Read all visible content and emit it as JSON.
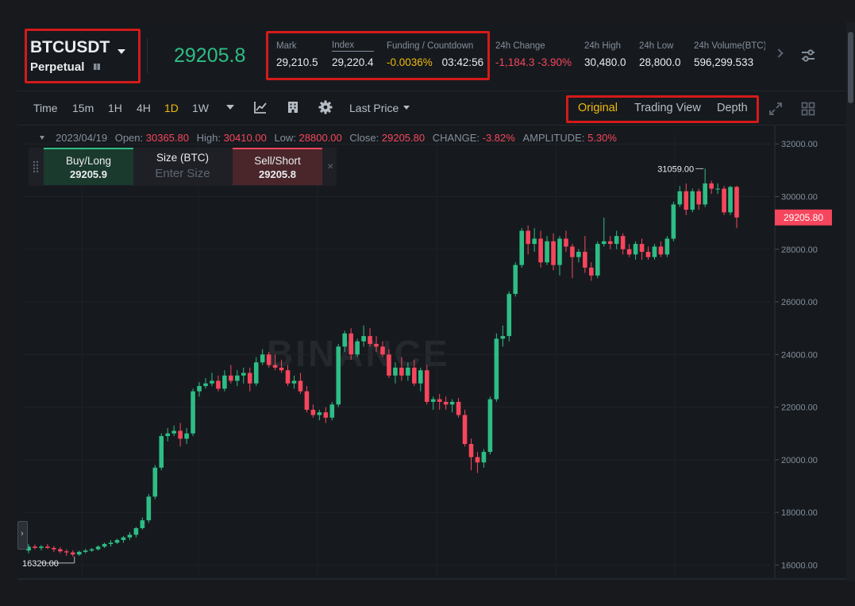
{
  "header": {
    "symbol": "BTCUSDT",
    "contract_type": "Perpetual",
    "last_price": "29205.8",
    "stats": {
      "mark_label": "Mark",
      "mark_value": "29,210.5",
      "index_label": "Index",
      "index_value": "29,220.4",
      "funding_label": "Funding / Countdown",
      "funding_value": "-0.0036%",
      "countdown_value": "03:42:56",
      "change_label": "24h Change",
      "change_value": "-1,184.3 -3.90%",
      "high_label": "24h High",
      "high_value": "30,480.0",
      "low_label": "24h Low",
      "low_value": "28,800.0",
      "volume_label": "24h Volume(BTC)",
      "volume_value": "596,299.533"
    }
  },
  "toolbar": {
    "time_label": "Time",
    "intervals": [
      "15m",
      "1H",
      "4H",
      "1D",
      "1W"
    ],
    "active_interval": "1D",
    "price_type": "Last Price",
    "views": [
      "Original",
      "Trading View",
      "Depth"
    ],
    "active_view": "Original"
  },
  "ohlc": {
    "date": "2023/04/19",
    "open_label": "Open:",
    "open": "30365.80",
    "high_label": "High:",
    "high": "30410.00",
    "low_label": "Low:",
    "low": "28800.00",
    "close_label": "Close:",
    "close": "29205.80",
    "change_label": "CHANGE:",
    "change": "-3.82%",
    "amplitude_label": "AMPLITUDE:",
    "amplitude": "5.30%"
  },
  "order_widget": {
    "buy_label": "Buy/Long",
    "buy_price": "29205.9",
    "size_label": "Size (BTC)",
    "size_placeholder": "Enter Size",
    "sell_label": "Sell/Short",
    "sell_price": "29205.8"
  },
  "watermark": "BINANCE",
  "chart_data": {
    "type": "candlestick",
    "y_ticks": [
      "32000.00",
      "30000.00",
      "28000.00",
      "26000.00",
      "24000.00",
      "22000.00",
      "20000.00",
      "18000.00",
      "16000.00"
    ],
    "ylim": [
      15500,
      32700
    ],
    "max_label": "31059.00",
    "min_label": "16320.00",
    "current_price_label": "29205.80",
    "colors": {
      "up": "#2ebd85",
      "down": "#f6465d",
      "grid": "#1f2227",
      "axis_text": "#848e9c"
    },
    "candles": [
      [
        16550,
        16800,
        16450,
        16700
      ],
      [
        16700,
        16780,
        16600,
        16650
      ],
      [
        16650,
        16760,
        16560,
        16700
      ],
      [
        16700,
        16800,
        16620,
        16650
      ],
      [
        16650,
        16720,
        16500,
        16600
      ],
      [
        16600,
        16680,
        16450,
        16520
      ],
      [
        16520,
        16600,
        16350,
        16480
      ],
      [
        16480,
        16560,
        16320,
        16400
      ],
      [
        16400,
        16550,
        16350,
        16500
      ],
      [
        16500,
        16620,
        16450,
        16550
      ],
      [
        16550,
        16650,
        16500,
        16600
      ],
      [
        16600,
        16750,
        16550,
        16700
      ],
      [
        16700,
        16850,
        16650,
        16800
      ],
      [
        16800,
        16950,
        16700,
        16850
      ],
      [
        16850,
        17000,
        16800,
        16950
      ],
      [
        16950,
        17100,
        16850,
        17050
      ],
      [
        17050,
        17250,
        16950,
        17150
      ],
      [
        17150,
        17450,
        17050,
        17400
      ],
      [
        17400,
        17800,
        17350,
        17700
      ],
      [
        17700,
        18700,
        17600,
        18600
      ],
      [
        18600,
        19800,
        18500,
        19700
      ],
      [
        19700,
        21000,
        19600,
        20900
      ],
      [
        20900,
        21200,
        20700,
        21000
      ],
      [
        21000,
        21300,
        20900,
        21100
      ],
      [
        21100,
        21400,
        20500,
        20800
      ],
      [
        20800,
        21200,
        20600,
        21000
      ],
      [
        21000,
        22700,
        20900,
        22600
      ],
      [
        22600,
        22950,
        22400,
        22800
      ],
      [
        22800,
        23100,
        22700,
        22900
      ],
      [
        22900,
        23300,
        22800,
        23000
      ],
      [
        23000,
        23200,
        22600,
        22700
      ],
      [
        22700,
        23400,
        22600,
        23200
      ],
      [
        23200,
        23600,
        22900,
        23000
      ],
      [
        23000,
        23400,
        22800,
        23200
      ],
      [
        23200,
        23500,
        22900,
        23300
      ],
      [
        23300,
        23500,
        22600,
        22900
      ],
      [
        22900,
        23900,
        22800,
        23700
      ],
      [
        23700,
        24200,
        23600,
        24000
      ],
      [
        24000,
        24100,
        23500,
        23600
      ],
      [
        23600,
        24000,
        23400,
        23500
      ],
      [
        23500,
        23800,
        23300,
        23400
      ],
      [
        23400,
        23600,
        22800,
        22900
      ],
      [
        22900,
        23200,
        22700,
        23000
      ],
      [
        23000,
        23300,
        22500,
        22600
      ],
      [
        22600,
        22800,
        21800,
        21900
      ],
      [
        21900,
        22100,
        21600,
        21700
      ],
      [
        21700,
        21900,
        21500,
        21800
      ],
      [
        21800,
        22000,
        21400,
        21600
      ],
      [
        21600,
        22200,
        21500,
        22100
      ],
      [
        22100,
        24400,
        22000,
        24300
      ],
      [
        24300,
        24900,
        24100,
        24800
      ],
      [
        24800,
        25000,
        23800,
        24000
      ],
      [
        24000,
        24600,
        23900,
        24500
      ],
      [
        24500,
        25100,
        24300,
        24700
      ],
      [
        24700,
        25000,
        24300,
        24400
      ],
      [
        24400,
        24700,
        24100,
        24300
      ],
      [
        24300,
        24500,
        23900,
        24000
      ],
      [
        24000,
        24200,
        23100,
        23200
      ],
      [
        23200,
        23700,
        22900,
        23500
      ],
      [
        23500,
        23900,
        23000,
        23200
      ],
      [
        23200,
        23700,
        23000,
        23500
      ],
      [
        23500,
        23800,
        22800,
        22900
      ],
      [
        22900,
        23500,
        22600,
        23400
      ],
      [
        23400,
        23600,
        22100,
        22200
      ],
      [
        22200,
        22400,
        21900,
        22300
      ],
      [
        22300,
        22500,
        21900,
        22200
      ],
      [
        22200,
        22400,
        21900,
        22100
      ],
      [
        22100,
        22300,
        21800,
        22200
      ],
      [
        22200,
        22350,
        21600,
        21700
      ],
      [
        21700,
        21900,
        20500,
        20600
      ],
      [
        20600,
        20800,
        19600,
        20100
      ],
      [
        20100,
        20300,
        19500,
        19900
      ],
      [
        19900,
        20400,
        19700,
        20300
      ],
      [
        20300,
        22400,
        20200,
        22300
      ],
      [
        22300,
        24800,
        22200,
        24600
      ],
      [
        24600,
        25100,
        24300,
        24700
      ],
      [
        24700,
        26400,
        24500,
        26300
      ],
      [
        26300,
        27500,
        26200,
        27400
      ],
      [
        27400,
        28800,
        27300,
        28700
      ],
      [
        28700,
        28900,
        27800,
        28200
      ],
      [
        28200,
        28800,
        27900,
        28400
      ],
      [
        28400,
        28700,
        27300,
        27500
      ],
      [
        27500,
        28500,
        27400,
        28300
      ],
      [
        28300,
        28600,
        27200,
        27400
      ],
      [
        27400,
        28500,
        27000,
        28400
      ],
      [
        28400,
        28700,
        27900,
        28100
      ],
      [
        28100,
        28200,
        26900,
        27700
      ],
      [
        27700,
        28000,
        27500,
        27900
      ],
      [
        27900,
        28500,
        27100,
        27300
      ],
      [
        27300,
        27500,
        26800,
        27000
      ],
      [
        27000,
        28300,
        26900,
        28200
      ],
      [
        28200,
        29200,
        28100,
        28300
      ],
      [
        28300,
        28500,
        28000,
        28200
      ],
      [
        28200,
        28700,
        28000,
        28500
      ],
      [
        28500,
        28600,
        27800,
        28000
      ],
      [
        28000,
        28200,
        27700,
        27800
      ],
      [
        27800,
        28300,
        27600,
        28200
      ],
      [
        28200,
        28400,
        27600,
        27900
      ],
      [
        27900,
        28100,
        27600,
        27700
      ],
      [
        27700,
        28200,
        27600,
        28100
      ],
      [
        28100,
        28300,
        27700,
        27800
      ],
      [
        27800,
        28500,
        27700,
        28400
      ],
      [
        28400,
        29800,
        28300,
        29700
      ],
      [
        29700,
        30400,
        29600,
        30200
      ],
      [
        30200,
        30500,
        29300,
        29500
      ],
      [
        29500,
        30300,
        29400,
        30200
      ],
      [
        30200,
        30300,
        29500,
        29700
      ],
      [
        29700,
        31059,
        29600,
        30500
      ],
      [
        30500,
        30600,
        30100,
        30300
      ],
      [
        30300,
        30500,
        30100,
        30300
      ],
      [
        30300,
        30400,
        29300,
        29400
      ],
      [
        29400,
        30400,
        29300,
        30366
      ],
      [
        30366,
        30410,
        28800,
        29206
      ]
    ]
  }
}
